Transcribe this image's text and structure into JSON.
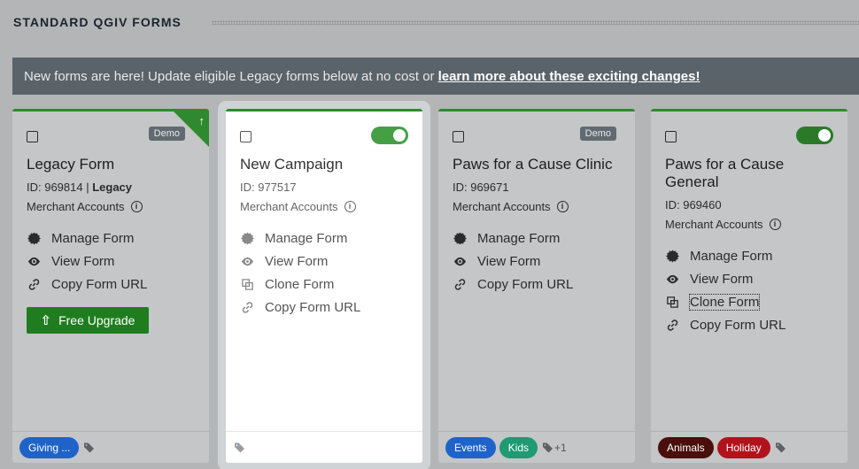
{
  "section": {
    "title": "STANDARD QGIV FORMS"
  },
  "banner": {
    "text": "New forms are here! Update eligible Legacy forms below at no cost or",
    "link": "learn more about these exciting changes!"
  },
  "cards": [
    {
      "title": "Legacy Form",
      "id_label": "ID: 969814",
      "id_suffix": "Legacy",
      "merchant": "Merchant Accounts",
      "badge": "Demo",
      "actions": [
        "Manage Form",
        "View Form",
        "Copy Form URL"
      ],
      "upgrade_label": "Free Upgrade",
      "tags": [
        {
          "label": "Giving ...",
          "color": "#1f63c9"
        }
      ]
    },
    {
      "title": "New Campaign",
      "id_label": "ID: 977517",
      "merchant": "Merchant Accounts",
      "actions": [
        "Manage Form",
        "View Form",
        "Clone Form",
        "Copy Form URL"
      ],
      "tags": []
    },
    {
      "title": "Paws for a Cause Clinic",
      "id_label": "ID: 969671",
      "merchant": "Merchant Accounts",
      "badge": "Demo",
      "actions": [
        "Manage Form",
        "View Form",
        "Copy Form URL"
      ],
      "tags": [
        {
          "label": "Events",
          "color": "#1f63c9"
        },
        {
          "label": "Kids",
          "color": "#1f9a72"
        }
      ],
      "more": "+1"
    },
    {
      "title": "Paws for a Cause General",
      "id_label": "ID: 969460",
      "merchant": "Merchant Accounts",
      "actions": [
        "Manage Form",
        "View Form",
        "Clone Form",
        "Copy Form URL"
      ],
      "tags": [
        {
          "label": "Animals",
          "color": "#4a0f0a"
        },
        {
          "label": "Holiday",
          "color": "#b2121c"
        }
      ]
    }
  ],
  "icons": {
    "manage": "gear-icon",
    "view": "eye-icon",
    "clone": "copy-icon",
    "copy_url": "link-icon",
    "tag": "tag-icon",
    "info": "info-icon",
    "upgrade": "arrow-up-icon"
  },
  "colors": {
    "accent_green": "#2f8a2f",
    "banner_bg": "#5a636a",
    "demo_badge": "#616a71"
  }
}
